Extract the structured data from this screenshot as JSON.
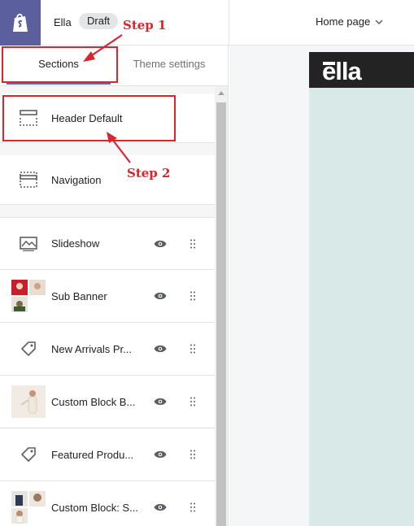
{
  "topbar": {
    "store_name": "Ella",
    "status_badge": "Draft",
    "page_selector": "Home page"
  },
  "tabs": [
    {
      "label": "Sections",
      "active": true
    },
    {
      "label": "Theme settings",
      "active": false
    }
  ],
  "sections": [
    {
      "label": "Header Default",
      "icon": "header-layout-icon"
    },
    {
      "label": "Navigation",
      "icon": "navigation-layout-icon"
    }
  ],
  "blocks": [
    {
      "label": "Slideshow",
      "icon": "slideshow-image-icon"
    },
    {
      "label": "Sub Banner",
      "icon": "thumbnail"
    },
    {
      "label": "New Arrivals Pr...",
      "icon": "tag-icon"
    },
    {
      "label": "Custom Block B...",
      "icon": "thumbnail"
    },
    {
      "label": "Featured Produ...",
      "icon": "tag-icon"
    },
    {
      "label": "Custom Block: S...",
      "icon": "thumbnail"
    }
  ],
  "preview": {
    "brand": "ella"
  },
  "annotations": {
    "step1": "Step 1",
    "step2": "Step 2",
    "color": "#d9262e"
  },
  "colors": {
    "shopify_purple": "#5c5f9e",
    "tab_underline": "#5c6ac4",
    "preview_bg": "#d9e9e8"
  }
}
